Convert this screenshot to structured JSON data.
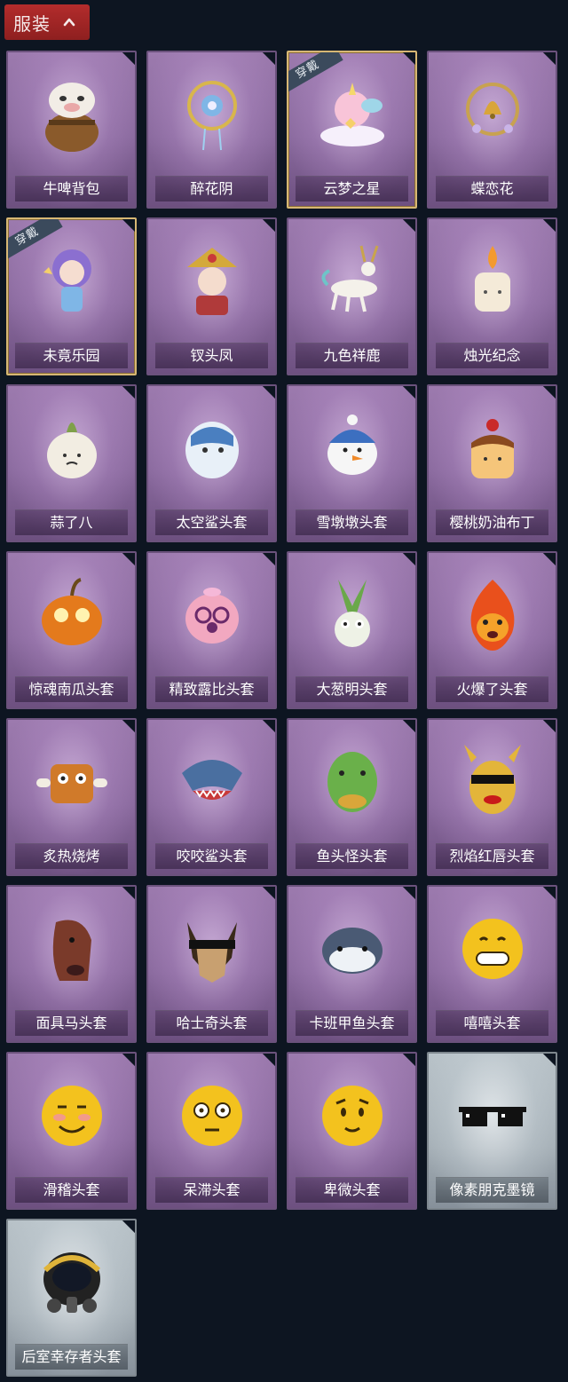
{
  "header": {
    "label": "服装"
  },
  "items": [
    {
      "name": "牛啤背包",
      "equipped": false,
      "rarity": "purple",
      "icon": "cow-beer-backpack-icon"
    },
    {
      "name": "醉花阴",
      "equipped": false,
      "rarity": "purple",
      "icon": "flower-dreamcatcher-icon"
    },
    {
      "name": "云梦之星",
      "equipped": true,
      "rarity": "purple",
      "icon": "unicorn-cloud-star-icon"
    },
    {
      "name": "蝶恋花",
      "equipped": false,
      "rarity": "purple",
      "icon": "butterfly-bell-wreath-icon"
    },
    {
      "name": "未竟乐园",
      "equipped": true,
      "rarity": "purple",
      "icon": "doll-girl-icon"
    },
    {
      "name": "钗头凤",
      "equipped": false,
      "rarity": "purple",
      "icon": "phoenix-crown-girl-icon"
    },
    {
      "name": "九色祥鹿",
      "equipped": false,
      "rarity": "purple",
      "icon": "nine-color-deer-icon"
    },
    {
      "name": "烛光纪念",
      "equipped": false,
      "rarity": "purple",
      "icon": "candle-icon"
    },
    {
      "name": "蒜了八",
      "equipped": false,
      "rarity": "purple",
      "icon": "garlic-head-icon"
    },
    {
      "name": "太空鲨头套",
      "equipped": false,
      "rarity": "purple",
      "icon": "space-shark-helmet-icon"
    },
    {
      "name": "雪墩墩头套",
      "equipped": false,
      "rarity": "purple",
      "icon": "snowman-helmet-icon"
    },
    {
      "name": "樱桃奶油布丁",
      "equipped": false,
      "rarity": "purple",
      "icon": "cherry-pudding-icon"
    },
    {
      "name": "惊魂南瓜头套",
      "equipped": false,
      "rarity": "purple",
      "icon": "pumpkin-head-icon"
    },
    {
      "name": "精致露比头套",
      "equipped": false,
      "rarity": "purple",
      "icon": "pink-beaver-head-icon"
    },
    {
      "name": "大葱明头套",
      "equipped": false,
      "rarity": "purple",
      "icon": "scallion-head-icon"
    },
    {
      "name": "火爆了头套",
      "equipped": false,
      "rarity": "purple",
      "icon": "fire-head-icon"
    },
    {
      "name": "炙热烧烤",
      "equipped": false,
      "rarity": "purple",
      "icon": "bbq-meat-head-icon"
    },
    {
      "name": "咬咬鲨头套",
      "equipped": false,
      "rarity": "purple",
      "icon": "shark-head-icon"
    },
    {
      "name": "鱼头怪头套",
      "equipped": false,
      "rarity": "purple",
      "icon": "fish-monster-mask-icon"
    },
    {
      "name": "烈焰红唇头套",
      "equipped": false,
      "rarity": "purple",
      "icon": "yellow-lips-mask-icon"
    },
    {
      "name": "面具马头套",
      "equipped": false,
      "rarity": "purple",
      "icon": "horse-mask-icon"
    },
    {
      "name": "哈士奇头套",
      "equipped": false,
      "rarity": "purple",
      "icon": "husky-sunglasses-icon"
    },
    {
      "name": "卡班甲鱼头套",
      "equipped": false,
      "rarity": "purple",
      "icon": "blue-fish-head-icon"
    },
    {
      "name": "嘻嘻头套",
      "equipped": false,
      "rarity": "purple",
      "icon": "grin-emoji-icon"
    },
    {
      "name": "滑稽头套",
      "equipped": false,
      "rarity": "purple",
      "icon": "funny-emoji-icon"
    },
    {
      "name": "呆滞头套",
      "equipped": false,
      "rarity": "purple",
      "icon": "dazed-emoji-icon"
    },
    {
      "name": "卑微头套",
      "equipped": false,
      "rarity": "purple",
      "icon": "humble-emoji-icon"
    },
    {
      "name": "像素朋克墨镜",
      "equipped": false,
      "rarity": "silver",
      "icon": "pixel-sunglasses-icon"
    },
    {
      "name": "后室幸存者头套",
      "equipped": false,
      "rarity": "silver",
      "icon": "gas-mask-helmet-icon"
    }
  ],
  "badge_label": "穿戴"
}
